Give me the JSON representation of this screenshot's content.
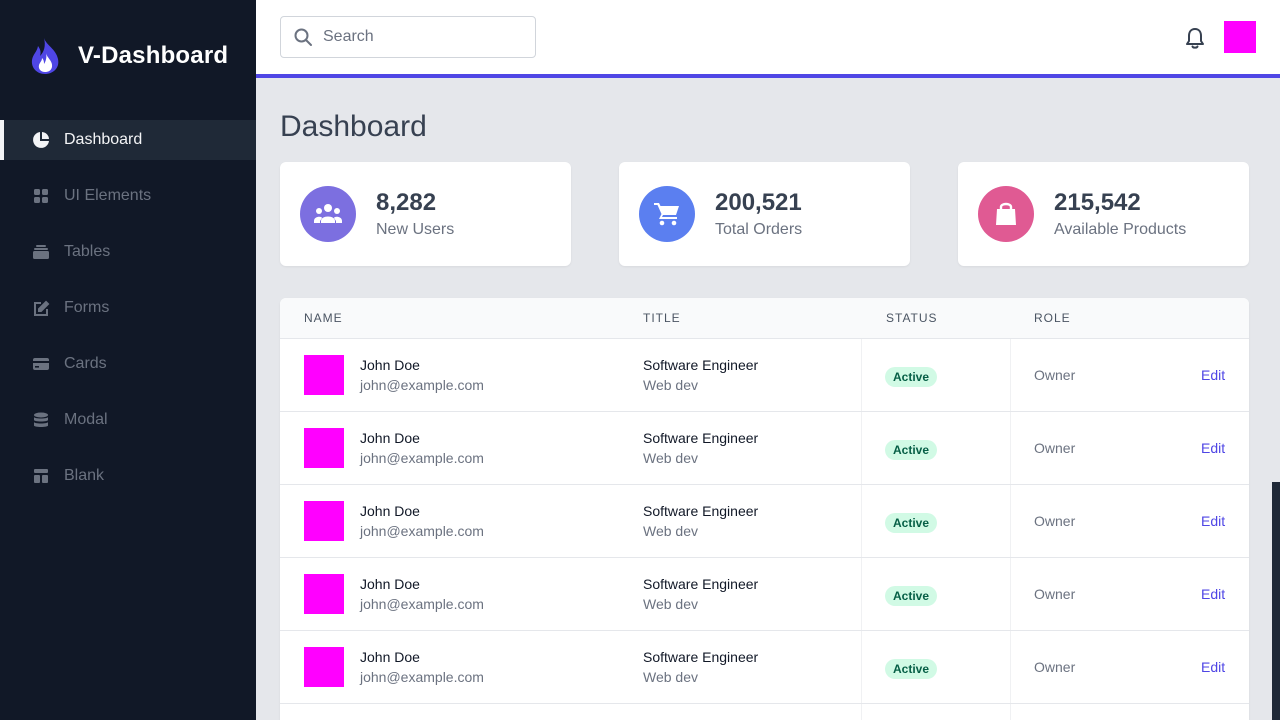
{
  "brand": {
    "title": "V-Dashboard",
    "accent": "#4f46e5"
  },
  "sidebar": {
    "items": [
      {
        "label": "Dashboard",
        "icon": "pie-chart-icon",
        "active": true
      },
      {
        "label": "UI Elements",
        "icon": "grid-icon",
        "active": false
      },
      {
        "label": "Tables",
        "icon": "stack-icon",
        "active": false
      },
      {
        "label": "Forms",
        "icon": "edit-icon",
        "active": false
      },
      {
        "label": "Cards",
        "icon": "credit-card-icon",
        "active": false
      },
      {
        "label": "Modal",
        "icon": "database-icon",
        "active": false
      },
      {
        "label": "Blank",
        "icon": "layout-icon",
        "active": false
      }
    ]
  },
  "header": {
    "search_placeholder": "Search",
    "search_value": "",
    "notifications_icon": "bell-icon",
    "avatar_color": "#ff00ff"
  },
  "main": {
    "title": "Dashboard",
    "stats": [
      {
        "value": "8,282",
        "label": "New Users",
        "icon": "users-icon",
        "color": "#7c6fe0"
      },
      {
        "value": "200,521",
        "label": "Total Orders",
        "icon": "cart-icon",
        "color": "#5b7ff0"
      },
      {
        "value": "215,542",
        "label": "Available Products",
        "icon": "shopping-bag-icon",
        "color": "#e05a93"
      }
    ],
    "table": {
      "headers": [
        "NAME",
        "TITLE",
        "STATUS",
        "ROLE"
      ],
      "rows": [
        {
          "name": "John Doe",
          "email": "john@example.com",
          "title": "Software Engineer",
          "department": "Web dev",
          "status": "Active",
          "role": "Owner",
          "action": "Edit"
        },
        {
          "name": "John Doe",
          "email": "john@example.com",
          "title": "Software Engineer",
          "department": "Web dev",
          "status": "Active",
          "role": "Owner",
          "action": "Edit"
        },
        {
          "name": "John Doe",
          "email": "john@example.com",
          "title": "Software Engineer",
          "department": "Web dev",
          "status": "Active",
          "role": "Owner",
          "action": "Edit"
        },
        {
          "name": "John Doe",
          "email": "john@example.com",
          "title": "Software Engineer",
          "department": "Web dev",
          "status": "Active",
          "role": "Owner",
          "action": "Edit"
        },
        {
          "name": "John Doe",
          "email": "john@example.com",
          "title": "Software Engineer",
          "department": "Web dev",
          "status": "Active",
          "role": "Owner",
          "action": "Edit"
        }
      ]
    }
  }
}
